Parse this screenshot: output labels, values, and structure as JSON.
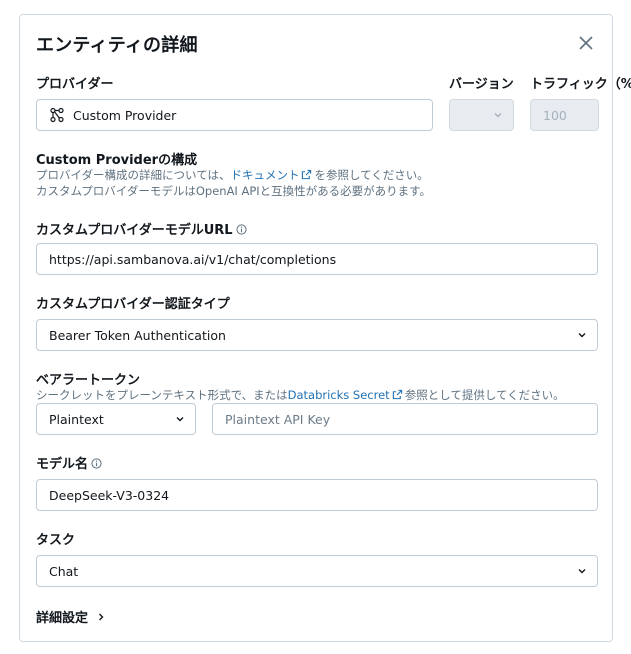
{
  "dialog": {
    "title": "エンティティの詳細"
  },
  "provider": {
    "header": "プロバイダー",
    "value": "Custom Provider",
    "icon": "custom-provider-icon"
  },
  "version": {
    "header": "バージョン",
    "value": ""
  },
  "traffic": {
    "header": "トラフィック（%",
    "value": "100"
  },
  "config": {
    "heading": "Custom Providerの構成",
    "line1_prefix": "プロバイダー構成の詳細については、",
    "line1_link": "ドキュメント",
    "line1_suffix": "を参照してください。",
    "line2": "カスタムプロバイダーモデルはOpenAI APIと互換性がある必要があります。"
  },
  "url": {
    "label": "カスタムプロバイダーモデルURL",
    "value": "https://api.sambanova.ai/v1/chat/completions"
  },
  "auth_type": {
    "label": "カスタムプロバイダー認証タイプ",
    "value": "Bearer Token Authentication"
  },
  "bearer": {
    "label": "ベアラートークン",
    "help_prefix": "シークレットをプレーンテキスト形式で、または",
    "help_link": "Databricks Secret",
    "help_suffix": "参照として提供してください。",
    "type_value": "Plaintext",
    "key_placeholder": "Plaintext API Key"
  },
  "model_name": {
    "label": "モデル名",
    "value": "DeepSeek-V3-0324"
  },
  "task": {
    "label": "タスク",
    "value": "Chat"
  },
  "advanced": {
    "label": "詳細設定"
  },
  "colors": {
    "link": "#2272b4",
    "border": "#c0cdd8",
    "muted": "#5f7281",
    "disabled_bg": "#e8ecf0"
  }
}
